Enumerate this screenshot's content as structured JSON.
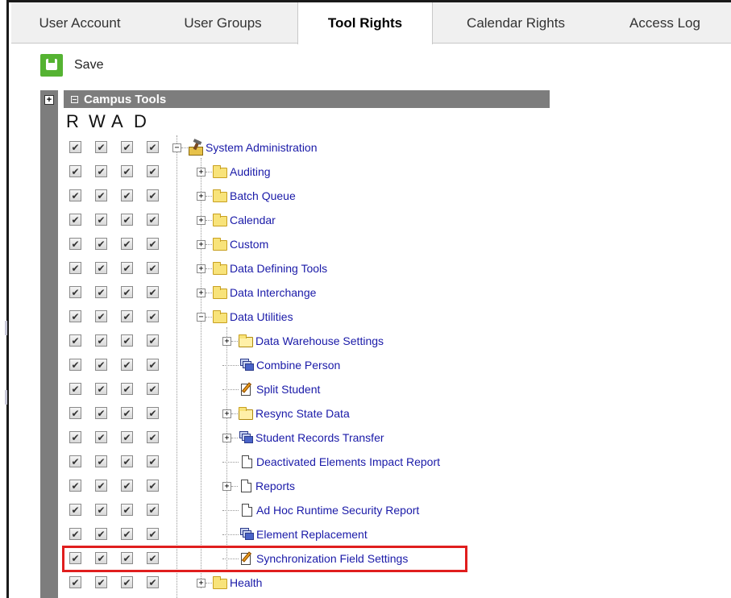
{
  "tabs": [
    {
      "label": "User Account",
      "active": false
    },
    {
      "label": "User Groups",
      "active": false
    },
    {
      "label": "Tool Rights",
      "active": true
    },
    {
      "label": "Calendar Rights",
      "active": false
    },
    {
      "label": "Access Log",
      "active": false
    }
  ],
  "toolbar": {
    "save_label": "Save",
    "save_icon": "floppy-disk-icon"
  },
  "tree": {
    "root_title": "Campus Tools",
    "rights_headers": [
      "R",
      "W",
      "A",
      "D"
    ],
    "nodes": [
      {
        "label": "System Administration",
        "icon": "toolkit-icon",
        "depth": 0,
        "expander": "minus",
        "checked": [
          true,
          true,
          true,
          true
        ]
      },
      {
        "label": "Auditing",
        "icon": "folder-icon",
        "depth": 1,
        "expander": "plus",
        "checked": [
          true,
          true,
          true,
          true
        ]
      },
      {
        "label": "Batch Queue",
        "icon": "folder-icon",
        "depth": 1,
        "expander": "plus",
        "checked": [
          true,
          true,
          true,
          true
        ]
      },
      {
        "label": "Calendar",
        "icon": "folder-icon",
        "depth": 1,
        "expander": "plus",
        "checked": [
          true,
          true,
          true,
          true
        ]
      },
      {
        "label": "Custom",
        "icon": "folder-icon",
        "depth": 1,
        "expander": "plus",
        "checked": [
          true,
          true,
          true,
          true
        ]
      },
      {
        "label": "Data Defining Tools",
        "icon": "folder-icon",
        "depth": 1,
        "expander": "plus",
        "checked": [
          true,
          true,
          true,
          true
        ]
      },
      {
        "label": "Data Interchange",
        "icon": "folder-icon",
        "depth": 1,
        "expander": "plus",
        "checked": [
          true,
          true,
          true,
          true
        ]
      },
      {
        "label": "Data Utilities",
        "icon": "folder-icon",
        "depth": 1,
        "expander": "minus",
        "checked": [
          true,
          true,
          true,
          true
        ]
      },
      {
        "label": "Data Warehouse Settings",
        "icon": "open-folder-icon",
        "depth": 2,
        "expander": "plus",
        "checked": [
          true,
          true,
          true,
          true
        ]
      },
      {
        "label": "Combine Person",
        "icon": "windows-icon",
        "depth": 2,
        "expander": "none",
        "checked": [
          true,
          true,
          true,
          true
        ]
      },
      {
        "label": "Split Student",
        "icon": "pencil-document-icon",
        "depth": 2,
        "expander": "none",
        "checked": [
          true,
          true,
          true,
          true
        ]
      },
      {
        "label": "Resync State Data",
        "icon": "open-folder-icon",
        "depth": 2,
        "expander": "plus",
        "checked": [
          true,
          true,
          true,
          true
        ]
      },
      {
        "label": "Student Records Transfer",
        "icon": "windows-icon",
        "depth": 2,
        "expander": "plus",
        "checked": [
          true,
          true,
          true,
          true
        ]
      },
      {
        "label": "Deactivated Elements Impact Report",
        "icon": "document-icon",
        "depth": 2,
        "expander": "none",
        "checked": [
          true,
          true,
          true,
          true
        ]
      },
      {
        "label": "Reports",
        "icon": "document-icon",
        "depth": 2,
        "expander": "plus",
        "checked": [
          true,
          true,
          true,
          true
        ]
      },
      {
        "label": "Ad Hoc Runtime Security Report",
        "icon": "document-icon",
        "depth": 2,
        "expander": "none",
        "checked": [
          true,
          true,
          true,
          true
        ]
      },
      {
        "label": "Element Replacement",
        "icon": "windows-icon",
        "depth": 2,
        "expander": "none",
        "checked": [
          true,
          true,
          true,
          true
        ]
      },
      {
        "label": "Synchronization Field Settings",
        "icon": "pencil-document-icon",
        "depth": 2,
        "expander": "none",
        "checked": [
          true,
          true,
          true,
          true
        ],
        "highlighted": true
      },
      {
        "label": "Health",
        "icon": "folder-icon",
        "depth": 1,
        "expander": "plus",
        "checked": [
          true,
          true,
          true,
          true
        ]
      }
    ]
  },
  "colors": {
    "highlight_border": "#e01e1e",
    "link_text": "#1a1aa8",
    "header_bar": "#7d7d7d",
    "save_green": "#55b332"
  }
}
